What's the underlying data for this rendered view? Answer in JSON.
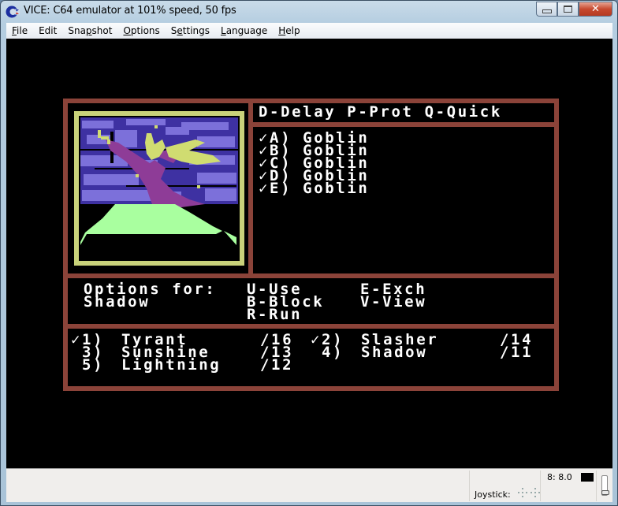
{
  "window": {
    "title": "VICE: C64 emulator at 101% speed, 50 fps",
    "controls": {
      "minimize": "minimize",
      "maximize": "maximize",
      "close": "close"
    }
  },
  "menu": [
    {
      "label": "File",
      "accel": "F",
      "rest": "ile"
    },
    {
      "label": "Edit",
      "accel": "",
      "rest": "Edit"
    },
    {
      "label": "Snapshot",
      "accel_pre": "Sna",
      "accel": "p",
      "rest": "shot"
    },
    {
      "label": "Options",
      "accel": "O",
      "rest": "ptions"
    },
    {
      "label": "Settings",
      "accel_pre": "S",
      "accel": "e",
      "rest": "ttings"
    },
    {
      "label": "Language",
      "accel": "L",
      "rest": "anguage"
    },
    {
      "label": "Help",
      "accel": "H",
      "rest": "elp"
    }
  ],
  "game": {
    "colors": {
      "border": "#8b4339",
      "text": "#ffffff",
      "portrait_frame": "#c9d27a",
      "sky_dark": "#3e31a2",
      "sky_light": "#7c70da",
      "figure": "#8e3c97",
      "hair": "#d0dc71",
      "ground": "#a9ff9f"
    },
    "commands_header": "D-Delay P-Prot Q-Quick",
    "enemies": [
      {
        "marker": "✓A)",
        "name": "Goblin"
      },
      {
        "marker": "✓B)",
        "name": "Goblin"
      },
      {
        "marker": "✓C)",
        "name": "Goblin"
      },
      {
        "marker": "✓D)",
        "name": "Goblin"
      },
      {
        "marker": "✓E)",
        "name": "Goblin"
      }
    ],
    "options": {
      "label": "Options for:",
      "character": "Shadow",
      "col1": [
        "U-Use",
        "B-Block",
        "R-Run"
      ],
      "col2": [
        "E-Exch",
        "V-View"
      ]
    },
    "party": [
      {
        "slot": "✓1)",
        "name": "Tyrant",
        "hp": "/16"
      },
      {
        "slot": "✓2)",
        "name": "Slasher",
        "hp": "/14"
      },
      {
        "slot": " 3)",
        "name": "Sunshine",
        "hp": "/13"
      },
      {
        "slot": " 4)",
        "name": "Shadow",
        "hp": "/11"
      },
      {
        "slot": " 5)",
        "name": "Lightning",
        "hp": "/12"
      }
    ]
  },
  "status": {
    "drive": "8: 8.0",
    "joystick_label": "Joystick:"
  }
}
